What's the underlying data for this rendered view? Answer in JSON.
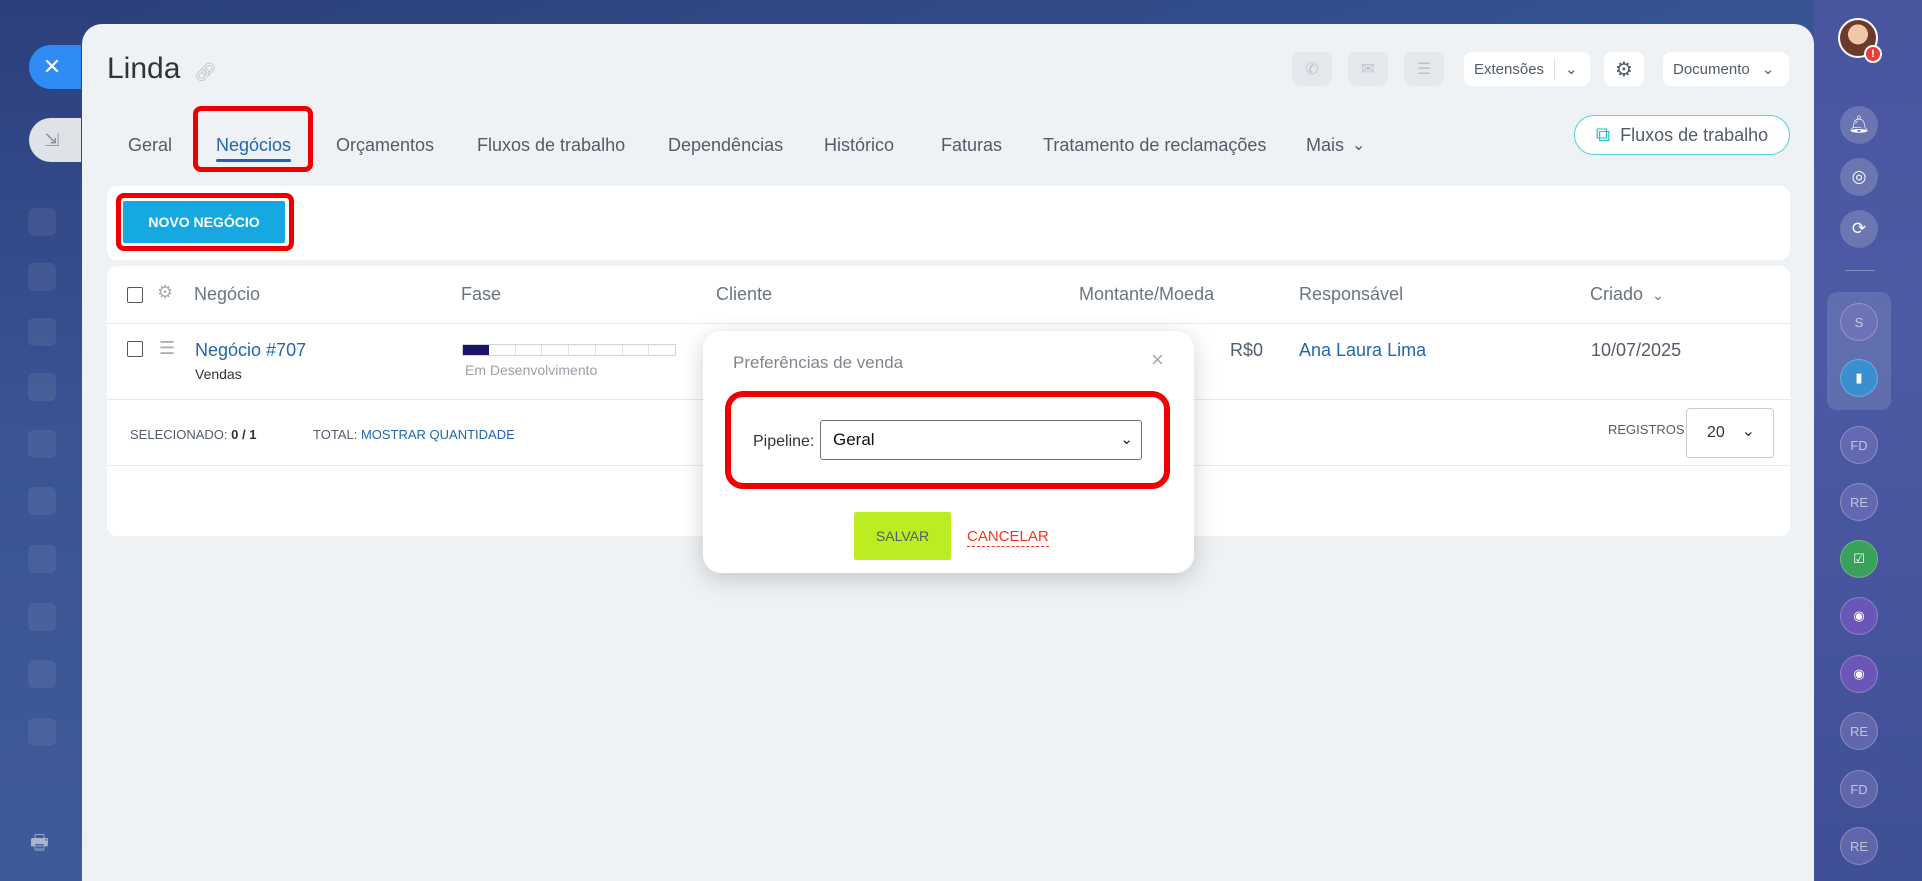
{
  "page": {
    "title": "Linda"
  },
  "header": {
    "extensions_label": "Extensões",
    "document_label": "Documento"
  },
  "tabs": [
    {
      "label": "Geral"
    },
    {
      "label": "Negócios"
    },
    {
      "label": "Orçamentos"
    },
    {
      "label": "Fluxos de trabalho"
    },
    {
      "label": "Dependências"
    },
    {
      "label": "Histórico"
    },
    {
      "label": "Faturas"
    },
    {
      "label": "Tratamento de reclamações"
    },
    {
      "label": "Mais"
    }
  ],
  "workflows_button": {
    "label": "Fluxos de trabalho"
  },
  "toolbar": {
    "new_deal_label": "NOVO NEGÓCIO"
  },
  "grid": {
    "columns": [
      "Negócio",
      "Fase",
      "Cliente",
      "Montante/Moeda",
      "Responsável",
      "Criado"
    ],
    "rows": [
      {
        "deal": "Negócio #707",
        "deal_sub": "Vendas",
        "stage_text": "Em Desenvolvimento",
        "stage_progress": 0.125,
        "amount": "R$0",
        "responsible": "Ana Laura Lima",
        "created": "10/07/2025"
      }
    ],
    "footer": {
      "selected_label": "SELECIONADO:",
      "selected_value": "0 / 1",
      "total_label": "TOTAL:",
      "total_link": "MOSTRAR QUANTIDADE",
      "records_label": "REGISTROS:",
      "records_value": "20"
    }
  },
  "modal": {
    "title": "Preferências de venda",
    "pipeline_label": "Pipeline:",
    "pipeline_value": "Geral",
    "save_label": "SALVAR",
    "cancel_label": "CANCELAR"
  },
  "right_panel": {
    "avatar_badge": "!",
    "items": [
      "S",
      "FD",
      "RE",
      "RE",
      "FD",
      "RE"
    ]
  },
  "colors": {
    "accent": "#2067b0",
    "new_button": "#16a8e0",
    "save_button": "#bbed21",
    "highlight": "#ee0000",
    "cancel": "#f0371b"
  }
}
